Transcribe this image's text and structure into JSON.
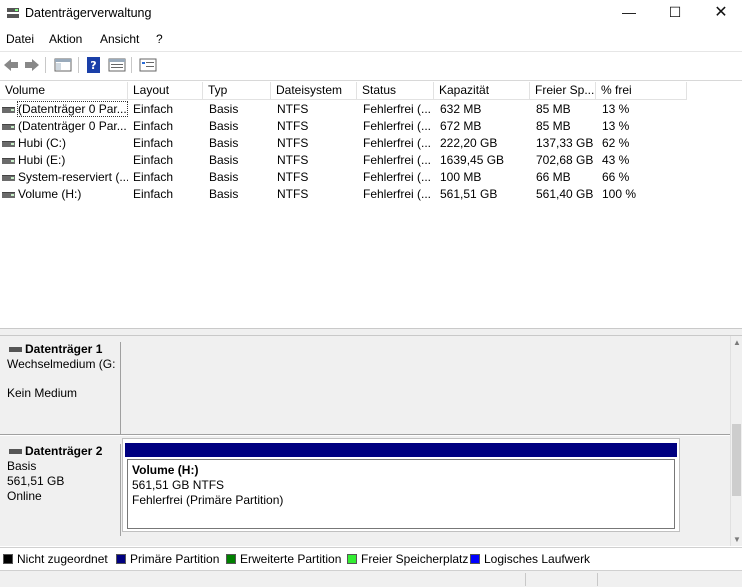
{
  "window": {
    "title": "Datenträgerverwaltung",
    "controls": {
      "minimize": "—",
      "maximize": "☐",
      "close": "✕"
    }
  },
  "menu": [
    "Datei",
    "Aktion",
    "Ansicht",
    "?"
  ],
  "toolbar": [
    "back-icon",
    "forward-icon",
    "console-tree-icon",
    "help-icon",
    "properties-icon",
    "view-icon"
  ],
  "columns": [
    "Volume",
    "Layout",
    "Typ",
    "Dateisystem",
    "Status",
    "Kapazität",
    "Freier Sp...",
    "% frei"
  ],
  "volumes": [
    {
      "name": "(Datenträger 0 Par...",
      "layout": "Einfach",
      "typ": "Basis",
      "fs": "NTFS",
      "status": "Fehlerfrei (...",
      "capacity": "632 MB",
      "free": "85 MB",
      "pct": "13 %"
    },
    {
      "name": "(Datenträger 0 Par...",
      "layout": "Einfach",
      "typ": "Basis",
      "fs": "NTFS",
      "status": "Fehlerfrei (...",
      "capacity": "672 MB",
      "free": "85 MB",
      "pct": "13 %"
    },
    {
      "name": "Hubi (C:)",
      "layout": "Einfach",
      "typ": "Basis",
      "fs": "NTFS",
      "status": "Fehlerfrei (...",
      "capacity": "222,20 GB",
      "free": "137,33 GB",
      "pct": "62 %"
    },
    {
      "name": "Hubi (E:)",
      "layout": "Einfach",
      "typ": "Basis",
      "fs": "NTFS",
      "status": "Fehlerfrei (...",
      "capacity": "1639,45 GB",
      "free": "702,68 GB",
      "pct": "43 %"
    },
    {
      "name": "System-reserviert (...",
      "layout": "Einfach",
      "typ": "Basis",
      "fs": "NTFS",
      "status": "Fehlerfrei (...",
      "capacity": "100 MB",
      "free": "66 MB",
      "pct": "66 %"
    },
    {
      "name": "Volume (H:)",
      "layout": "Einfach",
      "typ": "Basis",
      "fs": "NTFS",
      "status": "Fehlerfrei (...",
      "capacity": "561,51 GB",
      "free": "561,40 GB",
      "pct": "100 %"
    }
  ],
  "disks": {
    "disk1": {
      "name": "Datenträger 1",
      "type": "Wechselmedium (G:",
      "media": "Kein Medium"
    },
    "disk2": {
      "name": "Datenträger 2",
      "type": "Basis",
      "size": "561,51 GB",
      "state": "Online",
      "partition": {
        "title": "Volume  (H:)",
        "size_fs": "561,51 GB NTFS",
        "status": "Fehlerfrei (Primäre Partition)",
        "bar_color": "#000080"
      }
    }
  },
  "legend": [
    {
      "label": "Nicht zugeordnet",
      "color": "#000000"
    },
    {
      "label": "Primäre Partition",
      "color": "#000080"
    },
    {
      "label": "Erweiterte Partition",
      "color": "#008000"
    },
    {
      "label": "Freier Speicherplatz",
      "color": "#33ee33"
    },
    {
      "label": "Logisches Laufwerk",
      "color": "#0000ff"
    }
  ]
}
